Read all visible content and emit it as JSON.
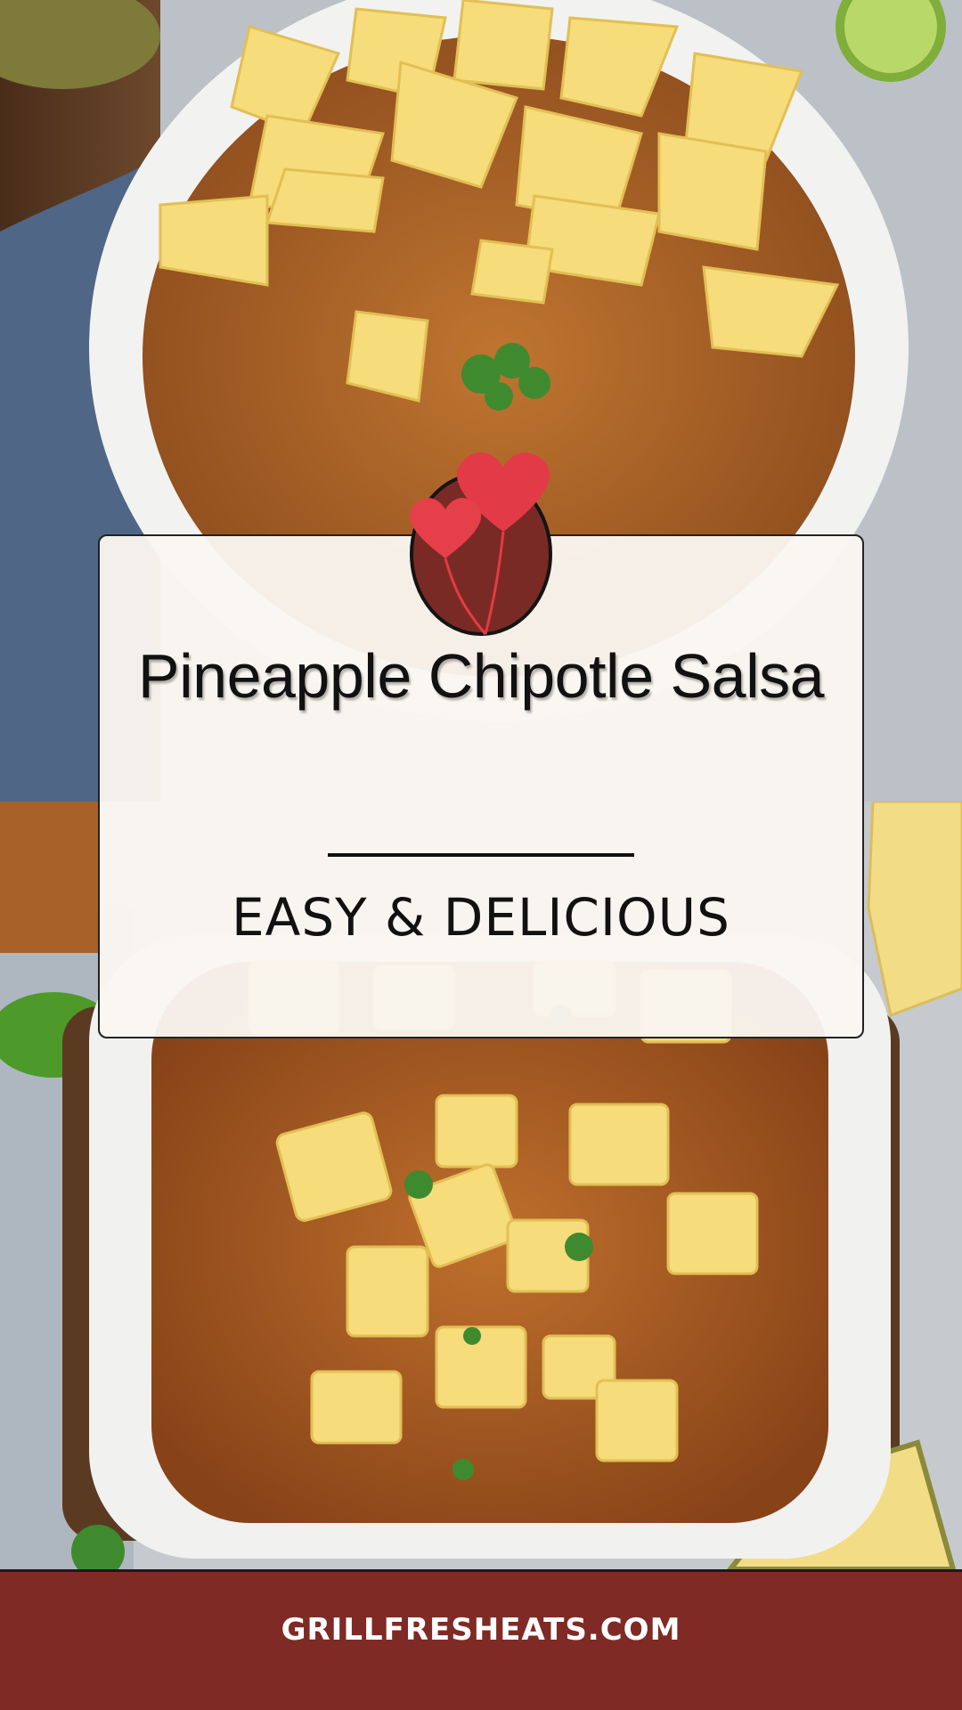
{
  "pin": {
    "title": "Pineapple Chipotle Salsa",
    "subtitle": "EASY & DELICIOUS",
    "website": "GRILLFRESHEATS.COM"
  },
  "colors": {
    "footer_background": "#7f2a24",
    "badge_background": "#7a2a24",
    "heart_red": "#e23b47",
    "salsa": "#b8692a",
    "pineapple": "#f6dc7a"
  },
  "photos": [
    {
      "subject": "salsa-bowl-with-pineapple-chunks",
      "position": "top"
    },
    {
      "subject": "salsa-bowl-with-pineapple-and-cilantro",
      "position": "bottom"
    }
  ]
}
